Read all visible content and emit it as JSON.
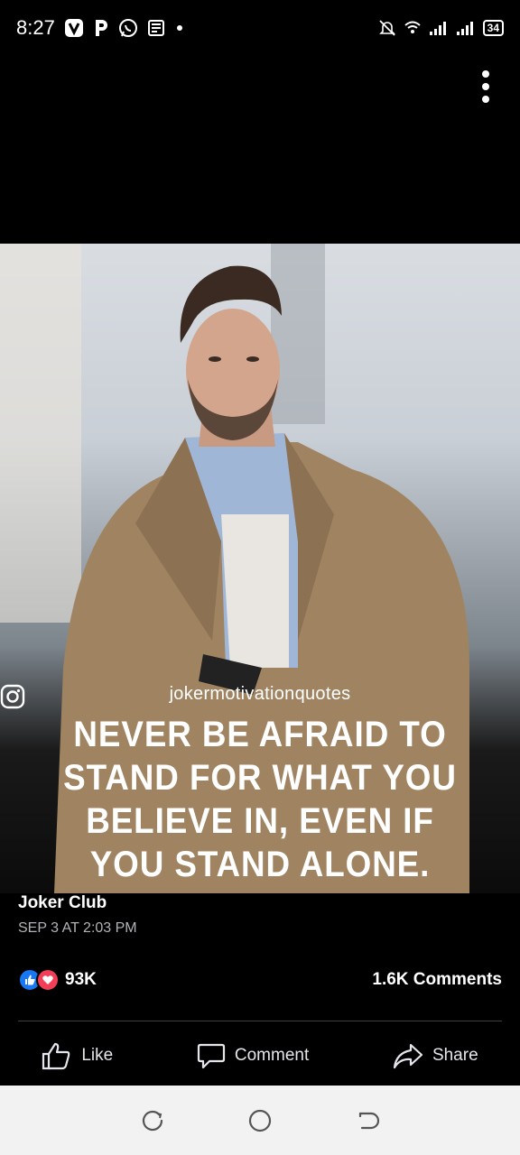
{
  "status_bar": {
    "time": "8:27",
    "battery": "34",
    "left_icons": [
      "v-app-icon",
      "p-app-icon",
      "whatsapp-icon",
      "news-icon",
      "dot-icon"
    ],
    "right_icons": [
      "mute-icon",
      "wifi-icon",
      "signal-icon",
      "signal-icon",
      "battery-icon"
    ]
  },
  "post": {
    "instagram_handle": "jokermotivationquotes",
    "quote": "NEVER BE AFRAID TO STAND FOR WHAT YOU BELIEVE IN, EVEN IF YOU STAND ALONE.",
    "page_name": "Joker Club",
    "timestamp": "SEP 3 AT 2:03 PM",
    "reaction_count": "93K",
    "comments_count": "1.6K Comments",
    "reaction_icons": [
      "like-icon",
      "love-icon"
    ]
  },
  "actions": {
    "like_label": "Like",
    "comment_label": "Comment",
    "share_label": "Share"
  },
  "colors": {
    "background": "#000000",
    "like_blue": "#1877f2",
    "love_red": "#f33e58",
    "secondary_text": "#b0b3b8",
    "nav_bar": "#f2f2f2"
  }
}
